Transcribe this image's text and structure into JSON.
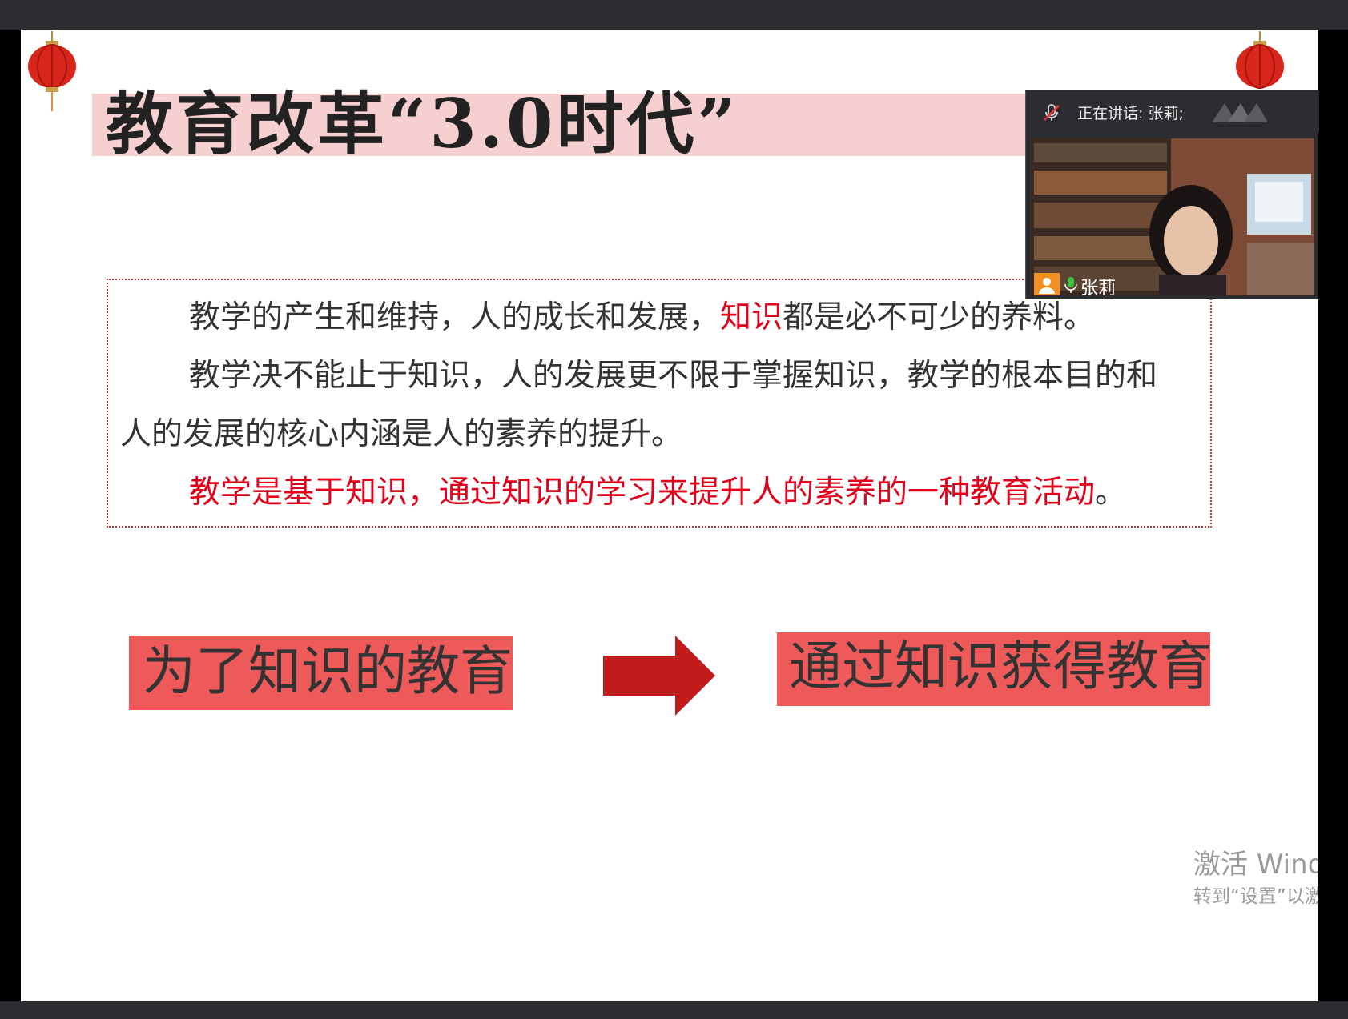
{
  "slide": {
    "title": "教育改革“3.0时代”",
    "paragraphs": {
      "p1_a": "教学的产生和维持，人的成长和发展，",
      "p1_red": "知识",
      "p1_b": "都是必不可少的养料。",
      "p2_line1": "教学决不能止于知识，人的发展更不限于掌握知识，教学的根本目的和",
      "p2_line2": "人的发展的核心内涵是人的素养的提升。",
      "p3_red": "教学是基于知识，通过知识的学习来提升人的素养的一种教育活动",
      "p3_end": "。"
    },
    "box_left": "为了知识的教育",
    "box_right": "通过知识获得教育"
  },
  "meeting": {
    "speaking_label": "正在讲话: 张莉;",
    "participant_name": "张莉"
  },
  "watermark": {
    "line1": "激活 Window",
    "line2": "转到“设置”以激活"
  },
  "colors": {
    "accent_red": "#e3001b",
    "box_red": "#ee5a5a",
    "title_band": "#f6d0d0"
  }
}
